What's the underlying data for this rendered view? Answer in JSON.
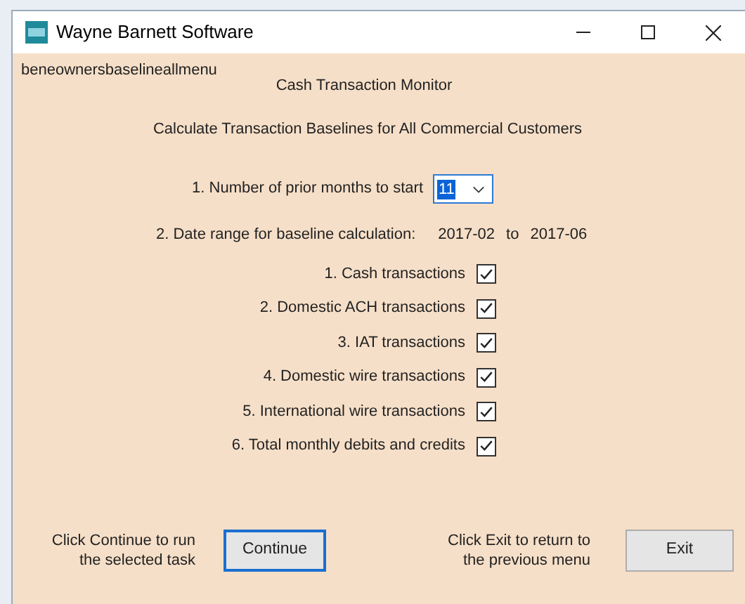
{
  "window": {
    "title": "Wayne Barnett Software"
  },
  "form_name": "beneownersbaselineallmenu",
  "heading": "Cash Transaction Monitor",
  "subheading": "Calculate Transaction Baselines for All Commercial Customers",
  "months": {
    "label": "1. Number of prior months to start",
    "value": "11"
  },
  "date_range": {
    "label": "2. Date range for baseline calculation:",
    "from": "2017-02",
    "separator": "to",
    "to": "2017-06"
  },
  "options": [
    {
      "label": "1. Cash transactions",
      "checked": true
    },
    {
      "label": "2. Domestic ACH transactions",
      "checked": true
    },
    {
      "label": "3. IAT transactions",
      "checked": true
    },
    {
      "label": "4. Domestic wire transactions",
      "checked": true
    },
    {
      "label": "5. International wire transactions",
      "checked": true
    },
    {
      "label": "6. Total monthly debits and credits",
      "checked": true
    }
  ],
  "continue": {
    "hint": "Click Continue to run the selected task",
    "button": "Continue"
  },
  "exit": {
    "hint": "Click Exit to return to the previous menu",
    "button": "Exit"
  }
}
